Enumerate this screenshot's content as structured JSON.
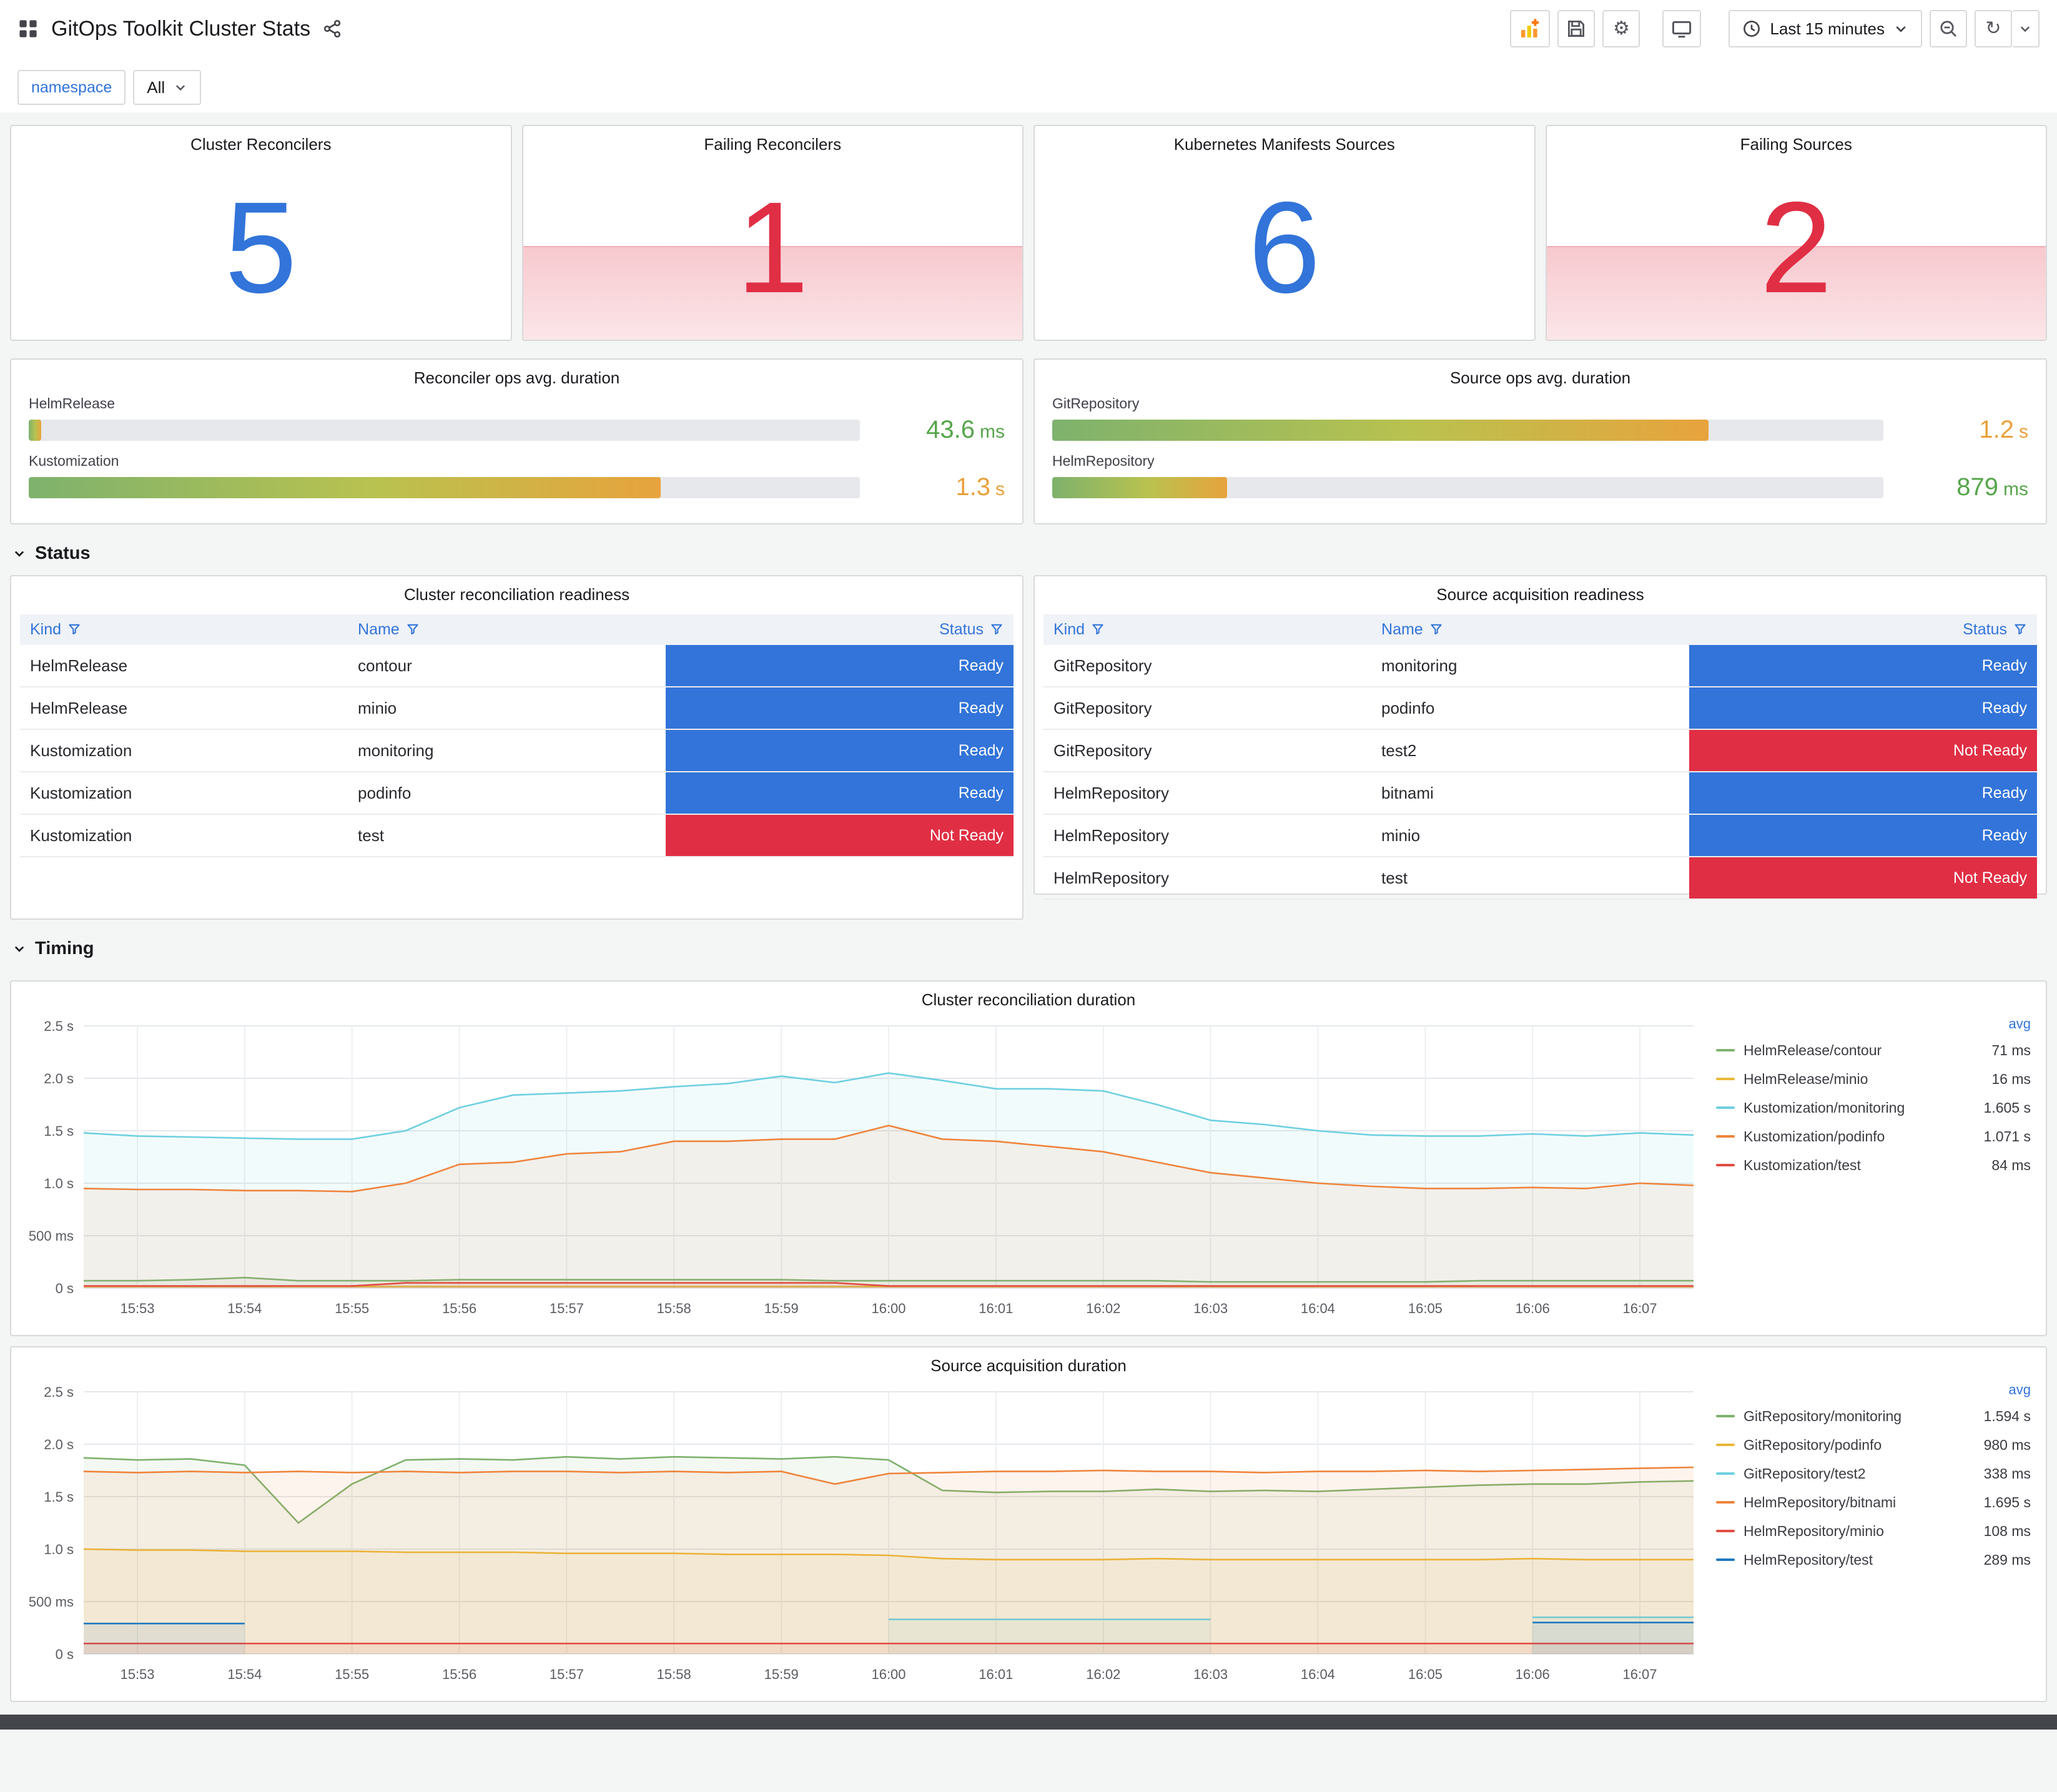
{
  "header": {
    "dashboard_title": "GitOps Toolkit Cluster Stats",
    "time_range_label": "Last 15 minutes"
  },
  "icons": {
    "settings": "⚙",
    "refresh": "↻"
  },
  "variables": {
    "label": "namespace",
    "value": "All"
  },
  "sections": {
    "status": {
      "label": "Status"
    },
    "timing": {
      "label": "Timing"
    }
  },
  "colors": {
    "accent_blue": "#3274D9",
    "alert_red": "#E02F44",
    "value_green": "#56A64B",
    "value_orange": "#E9A13C",
    "status": {
      "Ready": "#3274D9",
      "Not Ready": "#E02F44"
    }
  },
  "stats": [
    {
      "title": "Cluster Reconcilers",
      "value": "5",
      "color": "#3274D9",
      "alert": false
    },
    {
      "title": "Failing Reconcilers",
      "value": "1",
      "color": "#E02F44",
      "alert": true
    },
    {
      "title": "Kubernetes Manifests Sources",
      "value": "6",
      "color": "#3274D9",
      "alert": false
    },
    {
      "title": "Failing Sources",
      "value": "2",
      "color": "#E02F44",
      "alert": true
    }
  ],
  "gauges": [
    {
      "title": "Reconciler ops avg. duration",
      "rows": [
        {
          "label": "HelmRelease",
          "value": "43.6",
          "unit": "ms",
          "value_color": "#56A64B",
          "percent": 1.5
        },
        {
          "label": "Kustomization",
          "value": "1.3",
          "unit": "s",
          "value_color": "#E9A13C",
          "percent": 76
        }
      ]
    },
    {
      "title": "Source ops avg. duration",
      "rows": [
        {
          "label": "GitRepository",
          "value": "1.2",
          "unit": "s",
          "value_color": "#E9A13C",
          "percent": 79
        },
        {
          "label": "HelmRepository",
          "value": "879",
          "unit": "ms",
          "value_color": "#56A64B",
          "percent": 21
        }
      ]
    }
  ],
  "tables": [
    {
      "title": "Cluster reconciliation readiness",
      "columns": [
        "Kind",
        "Name",
        "Status"
      ],
      "rows": [
        {
          "kind": "HelmRelease",
          "name": "contour",
          "status": "Ready"
        },
        {
          "kind": "HelmRelease",
          "name": "minio",
          "status": "Ready"
        },
        {
          "kind": "Kustomization",
          "name": "monitoring",
          "status": "Ready"
        },
        {
          "kind": "Kustomization",
          "name": "podinfo",
          "status": "Ready"
        },
        {
          "kind": "Kustomization",
          "name": "test",
          "status": "Not Ready"
        }
      ]
    },
    {
      "title": "Source acquisition readiness",
      "columns": [
        "Kind",
        "Name",
        "Status"
      ],
      "rows": [
        {
          "kind": "GitRepository",
          "name": "monitoring",
          "status": "Ready"
        },
        {
          "kind": "GitRepository",
          "name": "podinfo",
          "status": "Ready"
        },
        {
          "kind": "GitRepository",
          "name": "test2",
          "status": "Not Ready"
        },
        {
          "kind": "HelmRepository",
          "name": "bitnami",
          "status": "Ready"
        },
        {
          "kind": "HelmRepository",
          "name": "minio",
          "status": "Ready"
        },
        {
          "kind": "HelmRepository",
          "name": "test",
          "status": "Not Ready"
        }
      ]
    }
  ],
  "chart_data": [
    {
      "type": "line",
      "title": "Cluster reconciliation duration",
      "ylim": [
        0,
        2.5
      ],
      "y_ticks": [
        0,
        0.5,
        1.0,
        1.5,
        2.0,
        2.5
      ],
      "y_tick_labels": [
        "0 s",
        "500 ms",
        "1.0 s",
        "1.5 s",
        "2.0 s",
        "2.5 s"
      ],
      "x_tick_labels": [
        "15:53",
        "15:54",
        "15:55",
        "15:56",
        "15:57",
        "15:58",
        "15:59",
        "16:00",
        "16:01",
        "16:02",
        "16:03",
        "16:04",
        "16:05",
        "16:06",
        "16:07"
      ],
      "x_step_minutes": 0.5,
      "legend_position": "right",
      "legend_value_header": "avg",
      "grid": true,
      "series": [
        {
          "name": "HelmRelease/contour",
          "color": "#7EB26D",
          "avg": "71 ms",
          "values": [
            0.07,
            0.07,
            0.08,
            0.1,
            0.07,
            0.07,
            0.07,
            0.08,
            0.08,
            0.08,
            0.08,
            0.08,
            0.08,
            0.08,
            0.07,
            0.07,
            0.07,
            0.07,
            0.07,
            0.07,
            0.07,
            0.06,
            0.06,
            0.06,
            0.06,
            0.06,
            0.07,
            0.07,
            0.07,
            0.07,
            0.07
          ]
        },
        {
          "name": "HelmRelease/minio",
          "color": "#EAB839",
          "avg": "16 ms",
          "values": [
            0.016,
            0.016,
            0.016,
            0.016,
            0.016,
            0.016,
            0.016,
            0.016,
            0.016,
            0.016,
            0.016,
            0.016,
            0.016,
            0.016,
            0.016,
            0.016,
            0.016,
            0.016,
            0.016,
            0.016,
            0.016,
            0.016,
            0.016,
            0.016,
            0.016,
            0.016,
            0.016,
            0.016,
            0.016,
            0.016,
            0.016
          ]
        },
        {
          "name": "Kustomization/monitoring",
          "color": "#6ED0E0",
          "avg": "1.605 s",
          "values": [
            1.48,
            1.45,
            1.44,
            1.43,
            1.42,
            1.42,
            1.5,
            1.72,
            1.84,
            1.86,
            1.88,
            1.92,
            1.95,
            2.02,
            1.96,
            2.05,
            1.98,
            1.9,
            1.9,
            1.88,
            1.75,
            1.6,
            1.56,
            1.5,
            1.46,
            1.45,
            1.45,
            1.47,
            1.45,
            1.48,
            1.46
          ]
        },
        {
          "name": "Kustomization/podinfo",
          "color": "#EF843C",
          "avg": "1.071 s",
          "values": [
            0.95,
            0.94,
            0.94,
            0.93,
            0.93,
            0.92,
            1.0,
            1.18,
            1.2,
            1.28,
            1.3,
            1.4,
            1.4,
            1.42,
            1.42,
            1.55,
            1.42,
            1.4,
            1.35,
            1.3,
            1.2,
            1.1,
            1.05,
            1.0,
            0.97,
            0.95,
            0.95,
            0.96,
            0.95,
            1.0,
            0.98
          ]
        },
        {
          "name": "Kustomization/test",
          "color": "#E24D42",
          "avg": "84 ms",
          "values": [
            0.02,
            0.02,
            0.02,
            0.02,
            0.02,
            0.02,
            0.05,
            0.05,
            0.05,
            0.05,
            0.05,
            0.05,
            0.05,
            0.05,
            0.05,
            0.02,
            0.02,
            0.02,
            0.02,
            0.02,
            0.02,
            0.02,
            0.02,
            0.02,
            0.02,
            0.02,
            0.02,
            0.02,
            0.02,
            0.02,
            0.02
          ]
        }
      ]
    },
    {
      "type": "line",
      "title": "Source acquisition duration",
      "ylim": [
        0,
        2.5
      ],
      "y_ticks": [
        0,
        0.5,
        1.0,
        1.5,
        2.0,
        2.5
      ],
      "y_tick_labels": [
        "0 s",
        "500 ms",
        "1.0 s",
        "1.5 s",
        "2.0 s",
        "2.5 s"
      ],
      "x_tick_labels": [
        "15:53",
        "15:54",
        "15:55",
        "15:56",
        "15:57",
        "15:58",
        "15:59",
        "16:00",
        "16:01",
        "16:02",
        "16:03",
        "16:04",
        "16:05",
        "16:06",
        "16:07"
      ],
      "x_step_minutes": 0.5,
      "legend_position": "right",
      "legend_value_header": "avg",
      "grid": true,
      "series": [
        {
          "name": "GitRepository/monitoring",
          "color": "#7EB26D",
          "avg": "1.594 s",
          "values": [
            1.87,
            1.85,
            1.86,
            1.8,
            1.25,
            1.62,
            1.85,
            1.86,
            1.85,
            1.88,
            1.86,
            1.88,
            1.87,
            1.86,
            1.88,
            1.85,
            1.56,
            1.54,
            1.55,
            1.55,
            1.57,
            1.55,
            1.56,
            1.55,
            1.57,
            1.59,
            1.61,
            1.62,
            1.62,
            1.64,
            1.65
          ]
        },
        {
          "name": "GitRepository/podinfo",
          "color": "#EAB839",
          "avg": "980 ms",
          "values": [
            1.0,
            0.99,
            0.99,
            0.98,
            0.98,
            0.98,
            0.97,
            0.97,
            0.97,
            0.96,
            0.96,
            0.96,
            0.95,
            0.95,
            0.95,
            0.94,
            0.91,
            0.9,
            0.9,
            0.9,
            0.91,
            0.9,
            0.9,
            0.9,
            0.9,
            0.9,
            0.9,
            0.91,
            0.9,
            0.9,
            0.9
          ]
        },
        {
          "name": "GitRepository/test2",
          "color": "#6ED0E0",
          "avg": "338 ms",
          "values": [
            null,
            null,
            null,
            null,
            null,
            null,
            null,
            null,
            null,
            null,
            null,
            null,
            null,
            null,
            null,
            0.33,
            0.33,
            0.33,
            0.33,
            0.33,
            0.33,
            0.33,
            null,
            null,
            null,
            null,
            null,
            0.35,
            0.35,
            0.35,
            0.35
          ]
        },
        {
          "name": "HelmRepository/bitnami",
          "color": "#EF843C",
          "avg": "1.695 s",
          "values": [
            1.74,
            1.73,
            1.74,
            1.73,
            1.74,
            1.73,
            1.74,
            1.73,
            1.74,
            1.74,
            1.73,
            1.74,
            1.73,
            1.74,
            1.62,
            1.72,
            1.73,
            1.74,
            1.74,
            1.75,
            1.74,
            1.74,
            1.73,
            1.74,
            1.74,
            1.75,
            1.74,
            1.75,
            1.76,
            1.77,
            1.78
          ]
        },
        {
          "name": "HelmRepository/minio",
          "color": "#E24D42",
          "avg": "108 ms",
          "values": [
            0.1,
            0.1,
            0.1,
            0.1,
            0.1,
            0.1,
            0.1,
            0.1,
            0.1,
            0.1,
            0.1,
            0.1,
            0.1,
            0.1,
            0.1,
            0.1,
            0.1,
            0.1,
            0.1,
            0.1,
            0.1,
            0.1,
            0.1,
            0.1,
            0.1,
            0.1,
            0.1,
            0.1,
            0.1,
            0.1,
            0.1
          ]
        },
        {
          "name": "HelmRepository/test",
          "color": "#1F78C1",
          "avg": "289 ms",
          "values": [
            0.29,
            0.29,
            0.29,
            0.29,
            null,
            null,
            null,
            null,
            null,
            null,
            null,
            null,
            null,
            null,
            null,
            null,
            null,
            null,
            null,
            null,
            null,
            null,
            null,
            null,
            null,
            null,
            null,
            0.3,
            0.3,
            0.3,
            0.3
          ]
        }
      ]
    }
  ]
}
